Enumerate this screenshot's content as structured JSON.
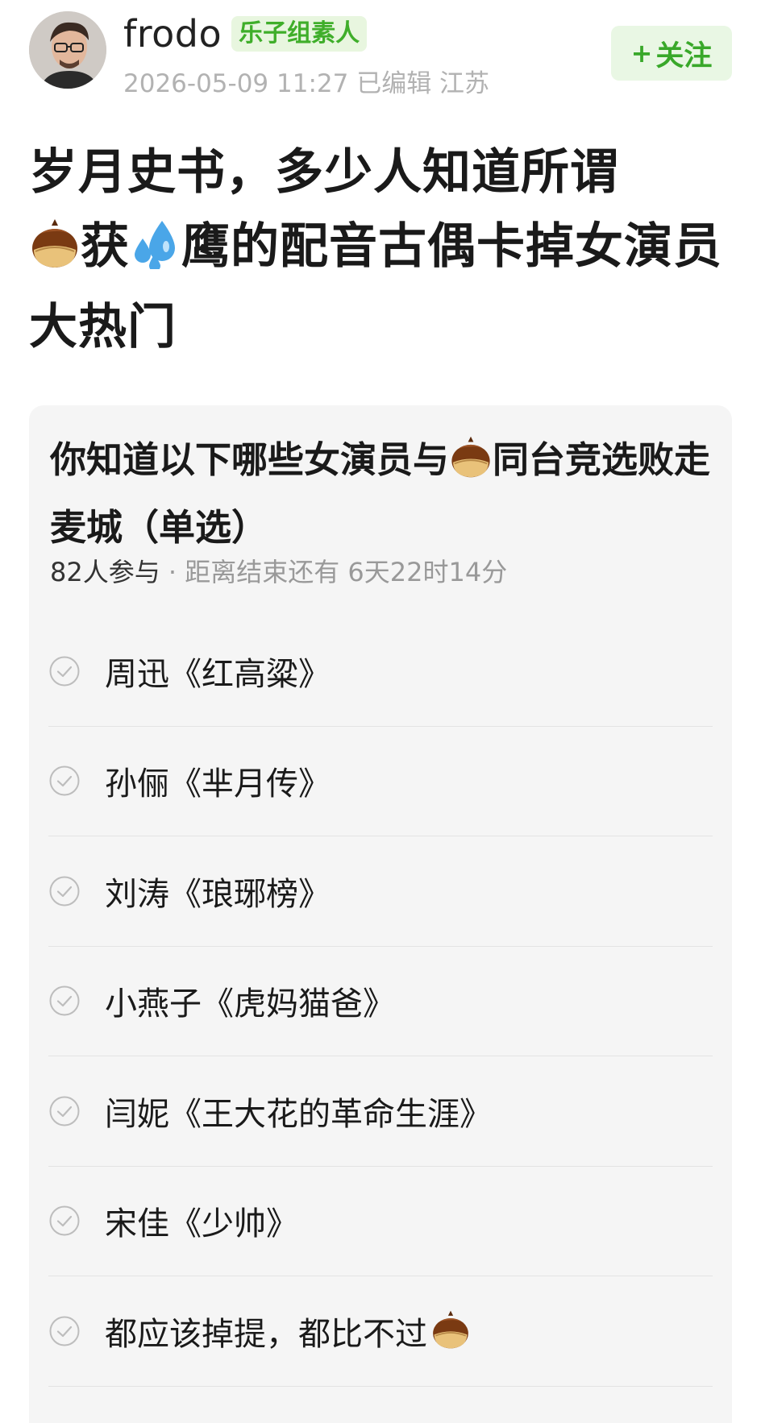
{
  "author": {
    "name": "frodo",
    "tag": "乐子组素人",
    "meta": "2026-05-09 11:27 已编辑 江苏"
  },
  "follow": {
    "label": "关注"
  },
  "post": {
    "title_part1": "岁月史书，多少人知道所谓",
    "title_part2": "获",
    "title_part3": "鹰的配音古偶卡掉女演员大热门"
  },
  "poll": {
    "question_part1": "你知道以下哪些女演员与",
    "question_part2": "同台竞选败走麦城（单选）",
    "participants": "82人参与",
    "separator": " · ",
    "remaining": "距离结束还有 6天22时14分",
    "options": [
      {
        "label": "周迅《红高粱》"
      },
      {
        "label": "孙俪《芈月传》"
      },
      {
        "label": "刘涛《琅琊榜》"
      },
      {
        "label": "小燕子《虎妈猫爸》"
      },
      {
        "label": "闫妮《王大花的革命生涯》"
      },
      {
        "label": "宋佳《少帅》"
      },
      {
        "label": "都应该掉提，都比不过"
      }
    ]
  },
  "colors": {
    "accent_green": "#39a82a",
    "tag_bg": "#e8f6df",
    "card_bg": "#f5f5f5",
    "meta_gray": "#b2b2b2"
  },
  "icons": [
    "avatar-photo",
    "chestnut-emoji",
    "droplets-emoji",
    "check-circle-icon"
  ]
}
